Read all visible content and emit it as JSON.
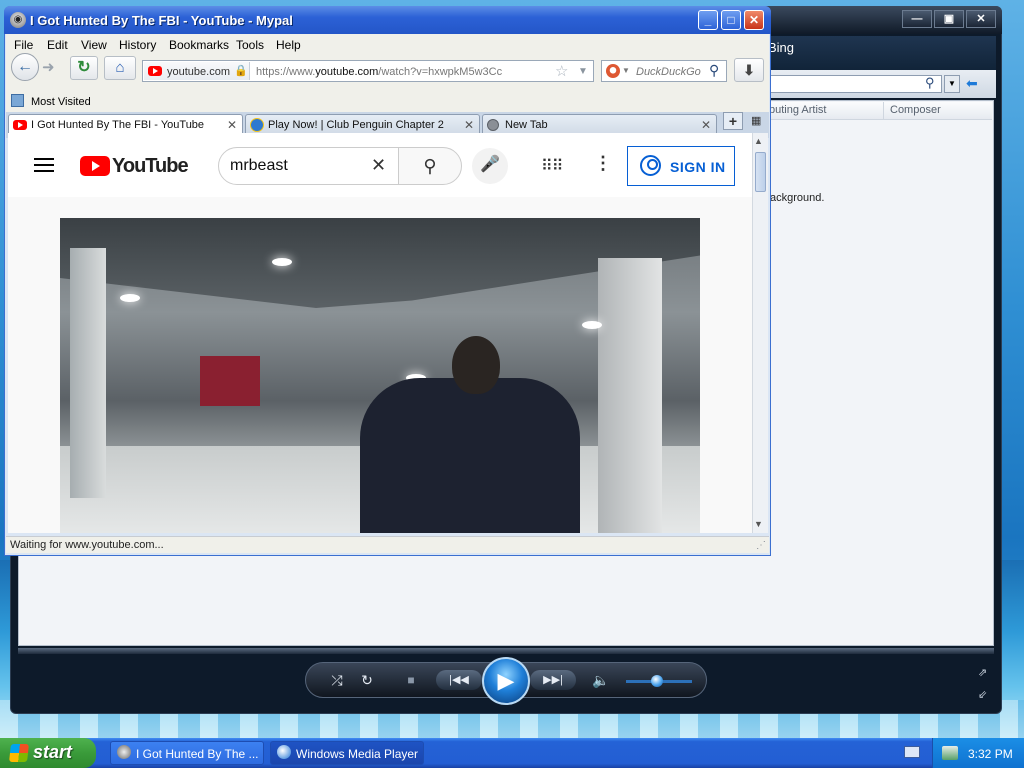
{
  "browser": {
    "title": "I Got Hunted By The FBI - YouTube - Mypal",
    "menu": [
      "File",
      "Edit",
      "View",
      "History",
      "Bookmarks",
      "Tools",
      "Help"
    ],
    "url_domain": "youtube.com",
    "url_prefix": "https://www.",
    "url_host": "youtube.com",
    "url_path": "/watch?v=hxwpkM5w3Cc",
    "search_engine": "DuckDuckGo",
    "bookmarks_folder": "Most Visited",
    "tabs": [
      {
        "label": "I Got Hunted By The FBI - YouTube",
        "active": true
      },
      {
        "label": "Play Now! | Club Penguin Chapter 2",
        "active": false
      },
      {
        "label": "New Tab",
        "active": false
      }
    ],
    "status": "Waiting for www.youtube.com..."
  },
  "youtube": {
    "logo_text": "YouTube",
    "search_value": "mrbeast",
    "sign_in": "SIGN IN"
  },
  "wmp": {
    "title": "Windows Media Player",
    "nav_label": "Bing",
    "columns": [
      "Contributing Artist",
      "Composer"
    ],
    "column_visible": [
      "buting Artist",
      "Composer"
    ],
    "body_fragment": "ackground."
  },
  "taskbar": {
    "start_label": "start",
    "buttons": [
      {
        "label": "I Got Hunted By The ..."
      },
      {
        "label": "Windows Media Player"
      }
    ],
    "clock": "3:32 PM"
  },
  "icons": {
    "back": "back-arrow-icon",
    "forward": "forward-arrow-icon",
    "reload": "reload-icon",
    "home": "home-icon",
    "lock": "lock-icon",
    "star": "bookmark-star-icon",
    "download": "download-icon"
  },
  "colors": {
    "xp_blue": "#2456c8",
    "youtube_red": "#ff0000",
    "signin_blue": "#065fd4",
    "start_green": "#3a9b3a"
  }
}
